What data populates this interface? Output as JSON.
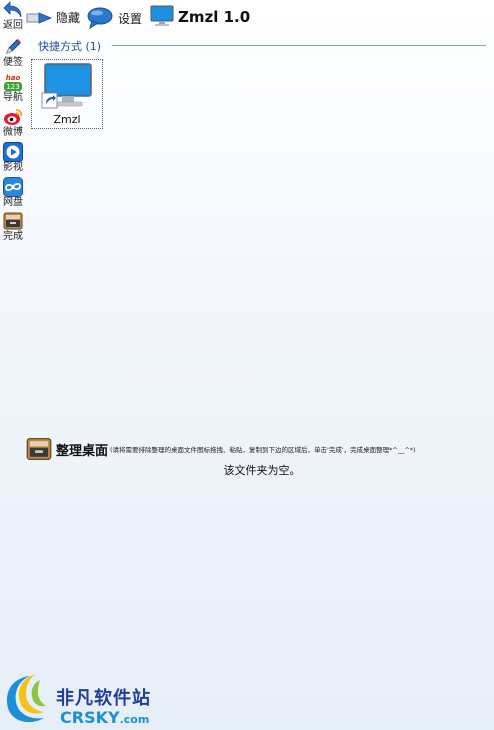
{
  "toolbar": {
    "back": "返回",
    "hide": "隐藏",
    "settings": "设置",
    "title": "Zmzl 1.0"
  },
  "sidebar": {
    "items": [
      {
        "label": "便签",
        "icon": "pencil-icon"
      },
      {
        "label": "导航",
        "icon": "hao123-icon"
      },
      {
        "label": "微博",
        "icon": "weibo-icon"
      },
      {
        "label": "影视",
        "icon": "video-play-icon"
      },
      {
        "label": "网盘",
        "icon": "cloud-disk-icon"
      },
      {
        "label": "完成",
        "icon": "box-icon"
      }
    ]
  },
  "shortcuts": {
    "group_title": "快捷方式 (1)",
    "items": [
      {
        "label": "Zmzl",
        "icon": "monitor-shortcut-icon"
      }
    ]
  },
  "tidy": {
    "title": "整理桌面",
    "hint": "(请将需要排除整理的桌面文件图标拖拽、粘贴，复制到下边的区域后，单击'完成'，完成桌面整理*^__^*)",
    "empty": "该文件夹为空。"
  },
  "watermark": {
    "cn": "非凡软件站",
    "en": "CRSKY",
    "domain": ".com"
  },
  "colors": {
    "accent": "#1f4ea3",
    "monitor": "#1e8fe0"
  }
}
